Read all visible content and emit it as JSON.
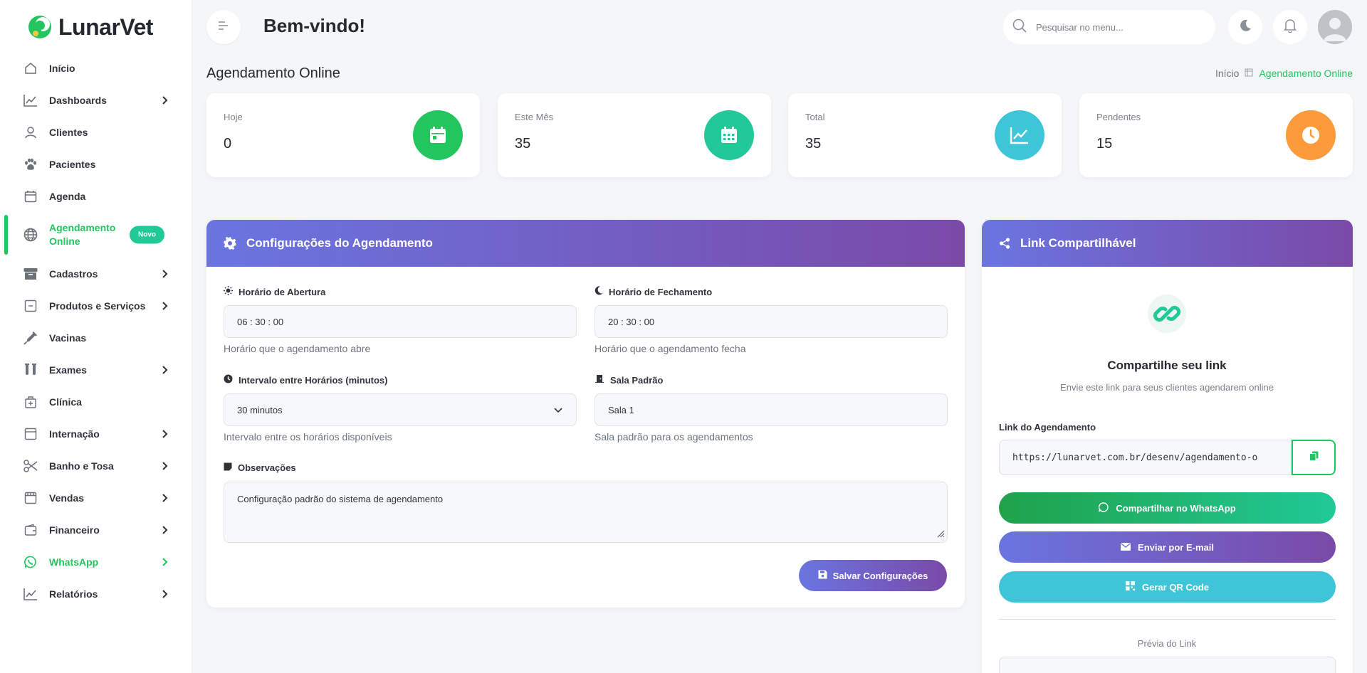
{
  "app": {
    "name": "LunarVet"
  },
  "sidebar": {
    "items": [
      {
        "label": "Início",
        "icon": "home-icon"
      },
      {
        "label": "Dashboards",
        "icon": "chart-line-icon",
        "has_children": true
      },
      {
        "label": "Clientes",
        "icon": "user-icon"
      },
      {
        "label": "Pacientes",
        "icon": "paw-icon"
      },
      {
        "label": "Agenda",
        "icon": "calendar-icon"
      },
      {
        "label": "Agendamento Online",
        "icon": "globe-icon",
        "badge": "Novo",
        "active": true
      },
      {
        "label": "Cadastros",
        "icon": "archive-icon",
        "has_children": true
      },
      {
        "label": "Produtos e Serviços",
        "icon": "box-icon",
        "has_children": true
      },
      {
        "label": "Vacinas",
        "icon": "syringe-icon"
      },
      {
        "label": "Exames",
        "icon": "test-tubes-icon",
        "has_children": true
      },
      {
        "label": "Clínica",
        "icon": "clinic-icon"
      },
      {
        "label": "Internação",
        "icon": "bed-icon",
        "has_children": true
      },
      {
        "label": "Banho e Tosa",
        "icon": "scissors-icon",
        "has_children": true
      },
      {
        "label": "Vendas",
        "icon": "store-icon",
        "has_children": true
      },
      {
        "label": "Financeiro",
        "icon": "wallet-icon",
        "has_children": true
      },
      {
        "label": "WhatsApp",
        "icon": "whatsapp-icon",
        "has_children": true,
        "highlight": true
      },
      {
        "label": "Relatórios",
        "icon": "chart-line-icon",
        "has_children": true
      }
    ]
  },
  "header": {
    "welcome": "Bem-vindo!",
    "search_placeholder": "Pesquisar no menu..."
  },
  "page": {
    "title": "Agendamento Online",
    "breadcrumb_home": "Início",
    "breadcrumb_current": "Agendamento Online"
  },
  "stats": [
    {
      "label": "Hoje",
      "value": "0",
      "color": "#22c55e",
      "icon": "calendar-day-icon"
    },
    {
      "label": "Este Mês",
      "value": "35",
      "color": "#20c997",
      "icon": "calendar-grid-icon"
    },
    {
      "label": "Total",
      "value": "35",
      "color": "#3ec6d8",
      "icon": "chart-line-icon"
    },
    {
      "label": "Pendentes",
      "value": "15",
      "color": "#fd9a3c",
      "icon": "clock-icon"
    }
  ],
  "config": {
    "title": "Configurações do Agendamento",
    "opening_label": "Horário de Abertura",
    "opening_value": "06 : 30 : 00",
    "opening_help": "Horário que o agendamento abre",
    "closing_label": "Horário de Fechamento",
    "closing_value": "20 : 30 : 00",
    "closing_help": "Horário que o agendamento fecha",
    "interval_label": "Intervalo entre Horários (minutos)",
    "interval_value": "30 minutos",
    "interval_help": "Intervalo entre os horários disponíveis",
    "room_label": "Sala Padrão",
    "room_value": "Sala 1",
    "room_help": "Sala padrão para os agendamentos",
    "notes_label": "Observações",
    "notes_value": "Configuração padrão do sistema de agendamento",
    "save_label": "Salvar Configurações"
  },
  "share": {
    "title": "Link Compartilhável",
    "heading": "Compartilhe seu link",
    "subheading": "Envie este link para seus clientes agendarem online",
    "link_label": "Link do Agendamento",
    "link_value": "https://lunarvet.com.br/desenv/agendamento-o",
    "whatsapp_label": "Compartilhar no WhatsApp",
    "email_label": "Enviar por E-mail",
    "qr_label": "Gerar QR Code",
    "preview_label": "Prévia do Link"
  },
  "colors": {
    "accent_green": "#22c55e",
    "gradient_start": "#6a75e0",
    "gradient_end": "#7a4aa8",
    "whatsapp_start": "#1fa24a",
    "whatsapp_end": "#20c997",
    "qr": "#3ec6d8"
  }
}
